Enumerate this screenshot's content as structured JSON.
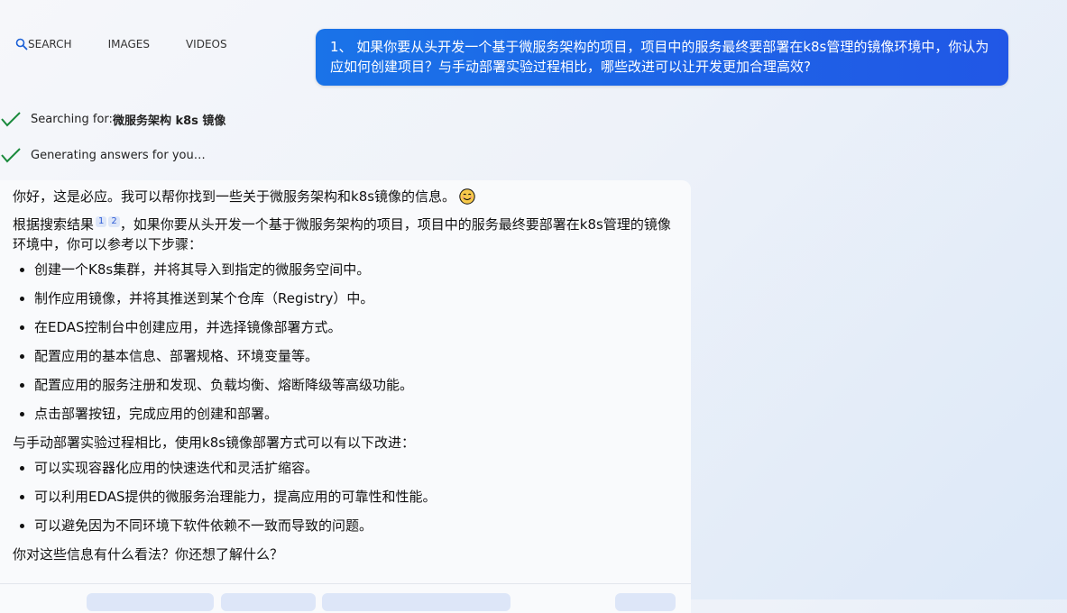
{
  "nav": {
    "search": "SEARCH",
    "images": "IMAGES",
    "videos": "VIDEOS"
  },
  "user_message": "1、 如果你要从头开发一个基于微服务架构的项目，项目中的服务最终要部署在k8s管理的镜像环境中，你认为应如何创建项目？与手动部署实验过程相比，哪些改进可以让开发更加合理高效?",
  "status": {
    "searching_prefix": "Searching for: ",
    "searching_query": "微服务架构 k8s 镜像",
    "generating": "Generating answers for you…"
  },
  "answer": {
    "greeting": "你好，这是必应。我可以帮你找到一些关于微服务架构和k8s镜像的信息。",
    "intro_prefix": "根据搜索结果",
    "cite1": "1",
    "cite2": "2",
    "intro_suffix": "，如果你要从头开发一个基于微服务架构的项目，项目中的服务最终要部署在k8s管理的镜像环境中，你可以参考以下步骤：",
    "steps": [
      "创建一个K8s集群，并将其导入到指定的微服务空间中。",
      "制作应用镜像，并将其推送到某个仓库（Registry）中。",
      "在EDAS控制台中创建应用，并选择镜像部署方式。",
      "配置应用的基本信息、部署规格、环境变量等。",
      "配置应用的服务注册和发现、负载均衡、熔断降级等高级功能。",
      "点击部署按钮，完成应用的创建和部署。"
    ],
    "compare": "与手动部署实验过程相比，使用k8s镜像部署方式可以有以下改进：",
    "improvements": [
      "可以实现容器化应用的快速迭代和灵活扩缩容。",
      "可以利用EDAS提供的微服务治理能力，提高应用的可靠性和性能。",
      "可以避免因为不同环境下软件依赖不一致而导致的问题。"
    ],
    "question": "你对这些信息有什么看法？你还想了解什么？"
  },
  "colors": {
    "accent": "#1a73e8",
    "check": "#1a8a3c",
    "chip": "#dde6f8"
  }
}
